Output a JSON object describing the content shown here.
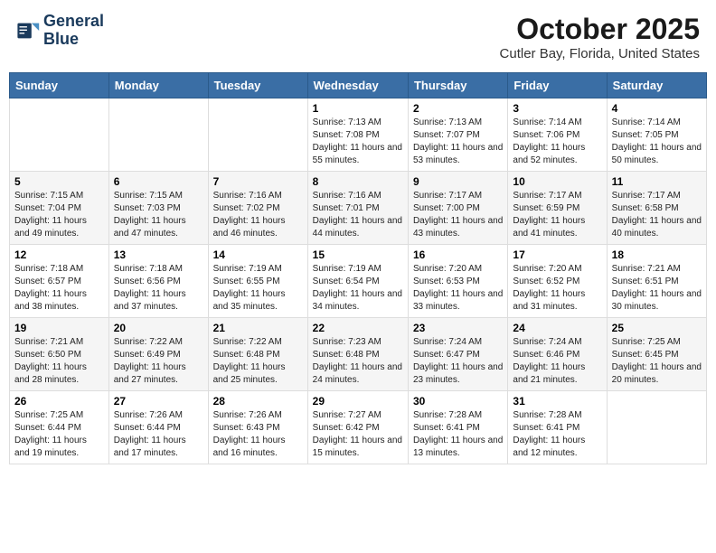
{
  "header": {
    "logo_line1": "General",
    "logo_line2": "Blue",
    "month": "October 2025",
    "location": "Cutler Bay, Florida, United States"
  },
  "weekdays": [
    "Sunday",
    "Monday",
    "Tuesday",
    "Wednesday",
    "Thursday",
    "Friday",
    "Saturday"
  ],
  "weeks": [
    [
      {
        "day": "",
        "info": ""
      },
      {
        "day": "",
        "info": ""
      },
      {
        "day": "",
        "info": ""
      },
      {
        "day": "1",
        "info": "Sunrise: 7:13 AM\nSunset: 7:08 PM\nDaylight: 11 hours and 55 minutes."
      },
      {
        "day": "2",
        "info": "Sunrise: 7:13 AM\nSunset: 7:07 PM\nDaylight: 11 hours and 53 minutes."
      },
      {
        "day": "3",
        "info": "Sunrise: 7:14 AM\nSunset: 7:06 PM\nDaylight: 11 hours and 52 minutes."
      },
      {
        "day": "4",
        "info": "Sunrise: 7:14 AM\nSunset: 7:05 PM\nDaylight: 11 hours and 50 minutes."
      }
    ],
    [
      {
        "day": "5",
        "info": "Sunrise: 7:15 AM\nSunset: 7:04 PM\nDaylight: 11 hours and 49 minutes."
      },
      {
        "day": "6",
        "info": "Sunrise: 7:15 AM\nSunset: 7:03 PM\nDaylight: 11 hours and 47 minutes."
      },
      {
        "day": "7",
        "info": "Sunrise: 7:16 AM\nSunset: 7:02 PM\nDaylight: 11 hours and 46 minutes."
      },
      {
        "day": "8",
        "info": "Sunrise: 7:16 AM\nSunset: 7:01 PM\nDaylight: 11 hours and 44 minutes."
      },
      {
        "day": "9",
        "info": "Sunrise: 7:17 AM\nSunset: 7:00 PM\nDaylight: 11 hours and 43 minutes."
      },
      {
        "day": "10",
        "info": "Sunrise: 7:17 AM\nSunset: 6:59 PM\nDaylight: 11 hours and 41 minutes."
      },
      {
        "day": "11",
        "info": "Sunrise: 7:17 AM\nSunset: 6:58 PM\nDaylight: 11 hours and 40 minutes."
      }
    ],
    [
      {
        "day": "12",
        "info": "Sunrise: 7:18 AM\nSunset: 6:57 PM\nDaylight: 11 hours and 38 minutes."
      },
      {
        "day": "13",
        "info": "Sunrise: 7:18 AM\nSunset: 6:56 PM\nDaylight: 11 hours and 37 minutes."
      },
      {
        "day": "14",
        "info": "Sunrise: 7:19 AM\nSunset: 6:55 PM\nDaylight: 11 hours and 35 minutes."
      },
      {
        "day": "15",
        "info": "Sunrise: 7:19 AM\nSunset: 6:54 PM\nDaylight: 11 hours and 34 minutes."
      },
      {
        "day": "16",
        "info": "Sunrise: 7:20 AM\nSunset: 6:53 PM\nDaylight: 11 hours and 33 minutes."
      },
      {
        "day": "17",
        "info": "Sunrise: 7:20 AM\nSunset: 6:52 PM\nDaylight: 11 hours and 31 minutes."
      },
      {
        "day": "18",
        "info": "Sunrise: 7:21 AM\nSunset: 6:51 PM\nDaylight: 11 hours and 30 minutes."
      }
    ],
    [
      {
        "day": "19",
        "info": "Sunrise: 7:21 AM\nSunset: 6:50 PM\nDaylight: 11 hours and 28 minutes."
      },
      {
        "day": "20",
        "info": "Sunrise: 7:22 AM\nSunset: 6:49 PM\nDaylight: 11 hours and 27 minutes."
      },
      {
        "day": "21",
        "info": "Sunrise: 7:22 AM\nSunset: 6:48 PM\nDaylight: 11 hours and 25 minutes."
      },
      {
        "day": "22",
        "info": "Sunrise: 7:23 AM\nSunset: 6:48 PM\nDaylight: 11 hours and 24 minutes."
      },
      {
        "day": "23",
        "info": "Sunrise: 7:24 AM\nSunset: 6:47 PM\nDaylight: 11 hours and 23 minutes."
      },
      {
        "day": "24",
        "info": "Sunrise: 7:24 AM\nSunset: 6:46 PM\nDaylight: 11 hours and 21 minutes."
      },
      {
        "day": "25",
        "info": "Sunrise: 7:25 AM\nSunset: 6:45 PM\nDaylight: 11 hours and 20 minutes."
      }
    ],
    [
      {
        "day": "26",
        "info": "Sunrise: 7:25 AM\nSunset: 6:44 PM\nDaylight: 11 hours and 19 minutes."
      },
      {
        "day": "27",
        "info": "Sunrise: 7:26 AM\nSunset: 6:44 PM\nDaylight: 11 hours and 17 minutes."
      },
      {
        "day": "28",
        "info": "Sunrise: 7:26 AM\nSunset: 6:43 PM\nDaylight: 11 hours and 16 minutes."
      },
      {
        "day": "29",
        "info": "Sunrise: 7:27 AM\nSunset: 6:42 PM\nDaylight: 11 hours and 15 minutes."
      },
      {
        "day": "30",
        "info": "Sunrise: 7:28 AM\nSunset: 6:41 PM\nDaylight: 11 hours and 13 minutes."
      },
      {
        "day": "31",
        "info": "Sunrise: 7:28 AM\nSunset: 6:41 PM\nDaylight: 11 hours and 12 minutes."
      },
      {
        "day": "",
        "info": ""
      }
    ]
  ]
}
